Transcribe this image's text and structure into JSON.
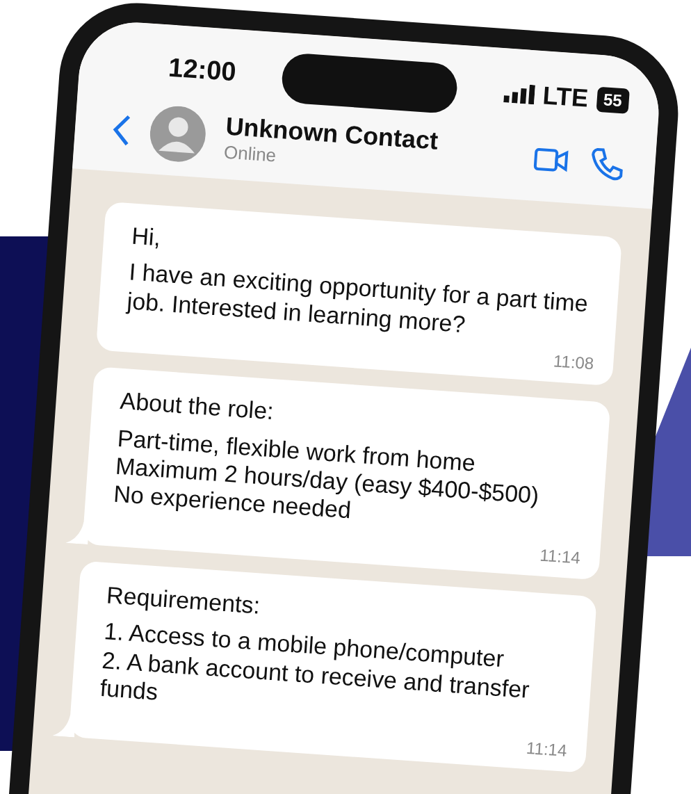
{
  "status_bar": {
    "time": "12:00",
    "network": "LTE",
    "battery": "55"
  },
  "header": {
    "contact_name": "Unknown Contact",
    "status": "Online"
  },
  "messages": [
    {
      "paragraphs": [
        "Hi,",
        "I have an exciting opportunity for a part time job. Interested in learning more?"
      ],
      "time": "11:08"
    },
    {
      "paragraphs": [
        "About the role:",
        "Part-time, flexible work from home",
        "Maximum 2 hours/day (easy $400-$500)",
        "No experience needed"
      ],
      "time": "11:14"
    },
    {
      "paragraphs": [
        "Requirements:",
        "1.  Access to a mobile phone/computer",
        "2.  A bank account to receive and transfer funds"
      ],
      "time": "11:14"
    }
  ]
}
